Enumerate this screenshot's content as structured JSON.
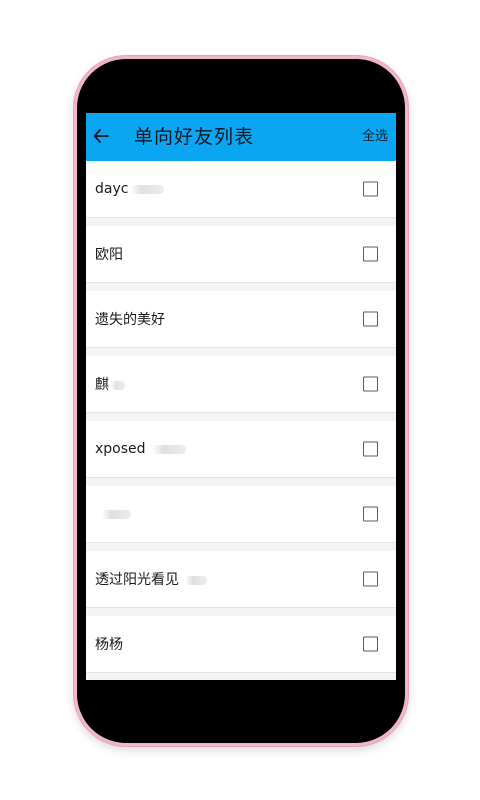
{
  "appbar": {
    "title": "单向好友列表",
    "select_all": "全选",
    "accent": "#0aa6f1"
  },
  "list": [
    {
      "name": "dayc",
      "checked": false
    },
    {
      "name": "欧阳",
      "checked": false
    },
    {
      "name": "遗失的美好",
      "checked": false
    },
    {
      "name": "麒",
      "checked": false
    },
    {
      "name": "xposed",
      "checked": false
    },
    {
      "name": "",
      "checked": false
    },
    {
      "name": "透过阳光看见",
      "checked": false
    },
    {
      "name": "杨杨",
      "checked": false
    }
  ],
  "icons": {
    "back": "arrow-left-icon",
    "checkbox": "checkbox-unchecked-icon"
  }
}
